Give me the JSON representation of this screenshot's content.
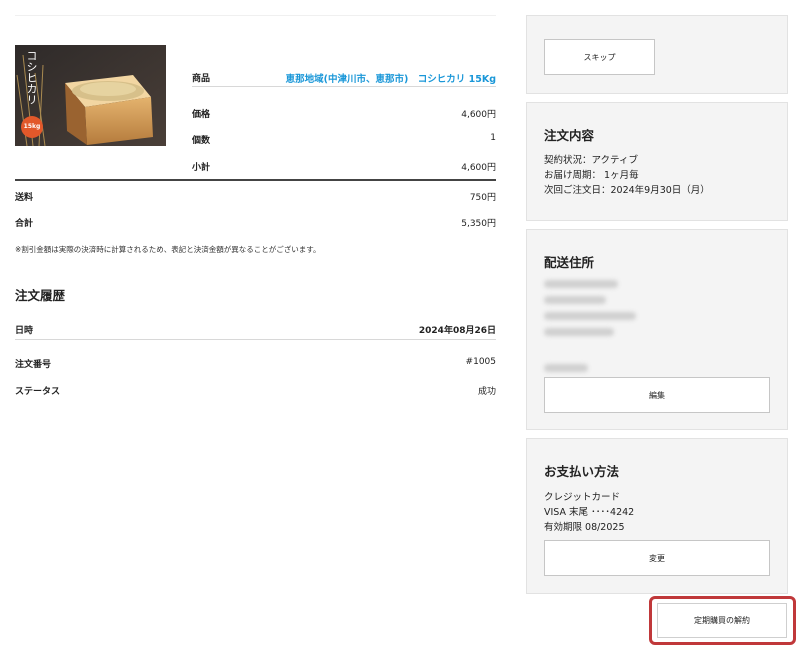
{
  "product": {
    "image_label": "コシヒカリ",
    "image_badge": "15kg",
    "product_label": "商品",
    "product_name": "恵那地域(中津川市、恵那市)　コシヒカリ 15Kg",
    "price_label": "価格",
    "price_value": "4,600円",
    "qty_label": "個数",
    "qty_value": "1",
    "subtotal_label": "小計",
    "subtotal_value": "4,600円"
  },
  "summary": {
    "shipping_label": "送料",
    "shipping_value": "750円",
    "total_label": "合計",
    "total_value": "5,350円",
    "notice": "※割引金額は実際の決済時に計算されるため、表記と決済金額が異なることがございます。"
  },
  "history": {
    "title": "注文履歴",
    "date_label": "日時",
    "date_value": "2024年08月26日",
    "order_no_label": "注文番号",
    "order_no_value": "#1005",
    "status_label": "ステータス",
    "status_value": "成功"
  },
  "skip_panel": {
    "skip_label": "スキップ"
  },
  "order_panel": {
    "title": "注文内容",
    "line1": "契約状況：アクティブ",
    "line2": "お届け周期： 1ヶ月毎",
    "line3": "次回ご注文日：2024年9月30日（月）"
  },
  "shipping_panel": {
    "title": "配送住所",
    "edit_label": "編集"
  },
  "payment_panel": {
    "title": "お支払い方法",
    "line1": "クレジットカード",
    "line2": "VISA 末尾 ････4242",
    "line3": "有効期限 08/2025",
    "change_label": "変更"
  },
  "cancel": {
    "label": "定期購買の解約"
  },
  "colors": {
    "link": "#1a97d8",
    "highlight": "#c0383a",
    "panel_bg": "#f4f4f4"
  }
}
